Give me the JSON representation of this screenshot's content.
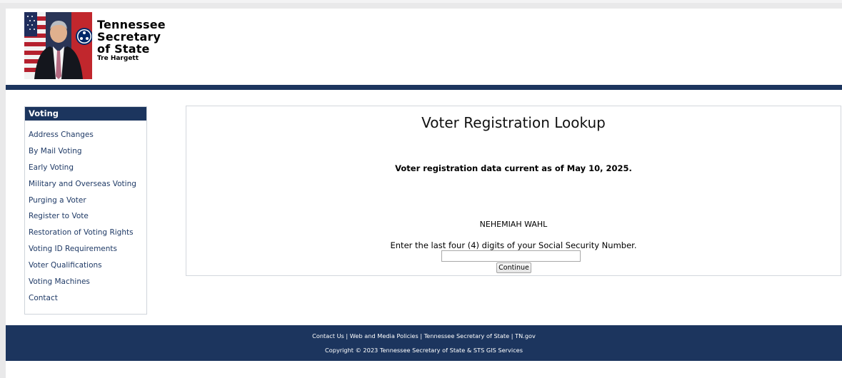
{
  "header": {
    "org_line1": "Tennessee",
    "org_line2": "Secretary",
    "org_line3": "of State",
    "official_name": "Tre Hargett",
    "colors": {
      "navy": "#1c355e"
    }
  },
  "sidebar": {
    "title": "Voting",
    "items": [
      {
        "label": "Address Changes"
      },
      {
        "label": "By Mail Voting"
      },
      {
        "label": "Early Voting"
      },
      {
        "label": "Military and Overseas Voting"
      },
      {
        "label": "Purging a Voter"
      },
      {
        "label": "Register to Vote"
      },
      {
        "label": "Restoration of Voting Rights"
      },
      {
        "label": "Voting ID Requirements"
      },
      {
        "label": "Voter Qualifications"
      },
      {
        "label": "Voting Machines"
      },
      {
        "label": "Contact"
      }
    ]
  },
  "main": {
    "title": "Voter Registration Lookup",
    "data_date": "Voter registration data current as of May 10, 2025.",
    "voter_name": "NEHEMIAH WAHL",
    "ssn_prompt": "Enter the last four (4) digits of your Social Security Number.",
    "ssn_value": "",
    "continue_label": "Continue"
  },
  "footer": {
    "links": [
      "Contact Us",
      "Web and Media Policies",
      "Tennessee Secretary of State",
      "TN.gov"
    ],
    "separator": " | ",
    "copyright": "Copyright © 2023 Tennessee Secretary of State & STS GIS Services"
  }
}
